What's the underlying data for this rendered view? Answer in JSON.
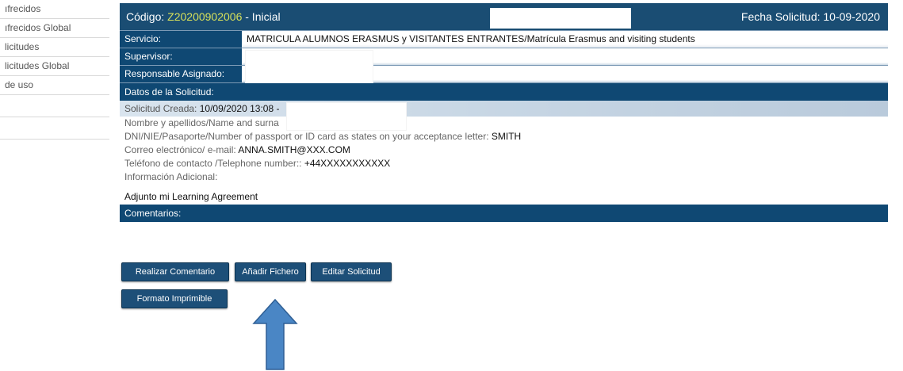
{
  "sidebar": {
    "items": [
      {
        "label": "ıfrecidos"
      },
      {
        "label": "ıfrecidos Global"
      },
      {
        "label": "licitudes"
      },
      {
        "label": "licitudes Global"
      },
      {
        "label": "de uso"
      }
    ]
  },
  "header": {
    "code_prefix": "Código: ",
    "code": "Z20200902006",
    "status": " - Inicial",
    "date": "Fecha Solicitud: 10-09-2020"
  },
  "fields": {
    "servicio_label": "Servicio:",
    "servicio_value": "MATRICULA ALUMNOS ERASMUS y VISITANTES ENTRANTES/Matrícula Erasmus and visiting students",
    "supervisor_label": "Supervisor:",
    "responsable_label": "Responsable Asignado:"
  },
  "datos": {
    "header": "Datos de la Solicitud:",
    "created_label": "Solicitud Creada: ",
    "created_value": "10/09/2020 13:08 -",
    "name_label": "Nombre y apellidos/Name and surna",
    "dni_label": "DNI/NIE/Pasaporte/Number of passport or ID card as states on your acceptance letter: ",
    "dni_value": "SMITH",
    "email_label": "Correo electrónico/ e-mail: ",
    "email_value": "ANNA.SMITH@XXX.COM",
    "phone_label": "Teléfono de contacto /Telephone number:: ",
    "phone_value": "+44XXXXXXXXXXX",
    "info_label": "Información Adicional:",
    "adjunto": "Adjunto mi Learning Agreement"
  },
  "comentarios": {
    "header": "Comentarios:"
  },
  "buttons": {
    "realizar": "Realizar Comentario",
    "anadir": "Añadir Fichero",
    "editar": "Editar Solicitud",
    "formato": "Formato Imprimible"
  },
  "colors": {
    "header_bg": "#1a4d73",
    "accent_code": "#d7e05a",
    "arrow": "#4a86c5"
  }
}
